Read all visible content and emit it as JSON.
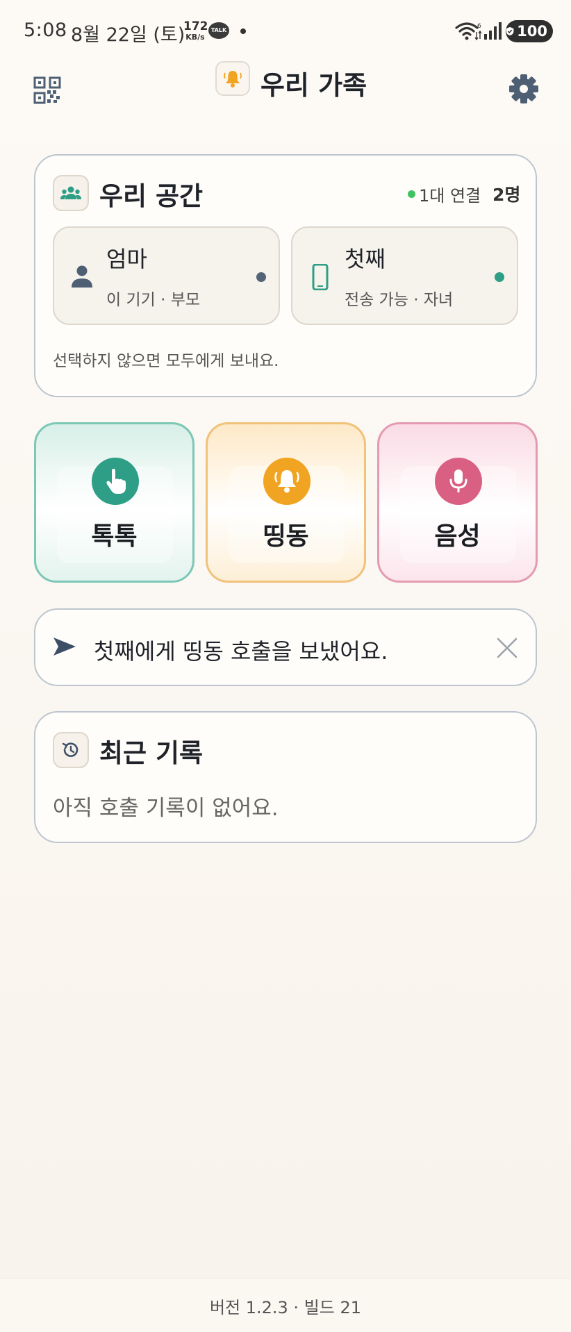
{
  "status_bar": {
    "time": "5:08",
    "date": "8월 22일 (토)",
    "net_speed": "172",
    "net_unit": "KB/s",
    "talk_badge": "TALK",
    "battery": "100",
    "icons": [
      "wifi-icon",
      "signal-icon",
      "battery-shield-icon"
    ]
  },
  "header": {
    "title": "우리 가족",
    "left_icon": "qr-code-icon",
    "logo_icon": "bell-icon",
    "right_icon": "gear-icon"
  },
  "space": {
    "title": "우리 공간",
    "connection": "1대 연결",
    "count": "2명",
    "members": [
      {
        "name": "엄마",
        "sub": "이 기기 · 부모",
        "icon": "person-icon",
        "dot_color": "#546478"
      },
      {
        "name": "첫째",
        "sub": "전송 가능 · 자녀",
        "icon": "phone-icon",
        "dot_color": "#2e9e86"
      }
    ],
    "note": "선택하지 않으면 모두에게 보내요."
  },
  "actions": [
    {
      "label": "톡톡",
      "icon": "tap-hand-icon",
      "color": "#2e9e86"
    },
    {
      "label": "띵동",
      "icon": "bell-icon",
      "color": "#f1a421"
    },
    {
      "label": "음성",
      "icon": "microphone-icon",
      "color": "#d95f83"
    }
  ],
  "message": {
    "text": "첫째에게 띵동 호출을 보냈어요.",
    "icon": "send-icon",
    "close_icon": "close-icon"
  },
  "recent": {
    "title": "최근 기록",
    "empty": "아직 호출 기록이 없어요.",
    "icon": "history-icon"
  },
  "footer": {
    "version": "버전 1.2.3 · 빌드 21"
  },
  "colors": {
    "accent_teal": "#2e9e86",
    "accent_orange": "#f1a421",
    "accent_pink": "#d95f83",
    "border": "#bcc5cf",
    "connected": "#3ec35e"
  }
}
